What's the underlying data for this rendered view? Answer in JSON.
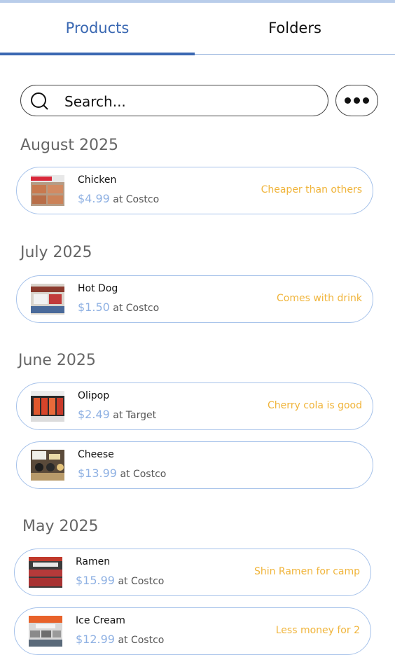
{
  "tabs": {
    "products": "Products",
    "folders": "Folders"
  },
  "search": {
    "placeholder": "Search..."
  },
  "icons": {
    "search": "search-icon",
    "more": "more-horizontal-icon"
  },
  "colors": {
    "accent": "#3a68b2",
    "price": "#8fb1e3",
    "note": "#f0b43a",
    "border": "#a6c2ea"
  },
  "groups": [
    {
      "month": "August 2025",
      "items": [
        {
          "name": "Chicken",
          "price": "$4.99",
          "store": "at Costco",
          "note": "Cheaper than others"
        }
      ]
    },
    {
      "month": "July 2025",
      "items": [
        {
          "name": "Hot Dog",
          "price": "$1.50",
          "store": "at Costco",
          "note": "Comes with drink"
        }
      ]
    },
    {
      "month": "June 2025",
      "items": [
        {
          "name": "Olipop",
          "price": "$2.49",
          "store": "at Target",
          "note": "Cherry cola is good"
        },
        {
          "name": "Cheese",
          "price": "$13.99",
          "store": "at Costco",
          "note": ""
        }
      ]
    },
    {
      "month": "May 2025",
      "items": [
        {
          "name": "Ramen",
          "price": "$15.99",
          "store": "at Costco",
          "note": "Shin Ramen for camp"
        },
        {
          "name": "Ice Cream",
          "price": "$12.99",
          "store": "at Costco",
          "note": "Less money for 2"
        }
      ]
    }
  ]
}
